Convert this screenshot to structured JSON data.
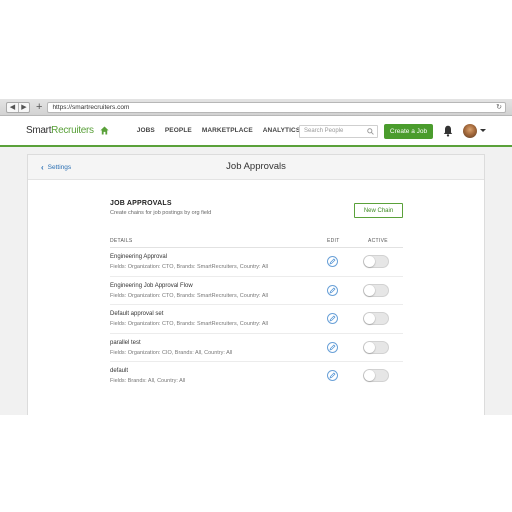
{
  "browser": {
    "url": "https://smartrecruiters.com"
  },
  "header": {
    "logo_smart": "Smart",
    "logo_recruiters": "Recruiters",
    "menu": [
      "JOBS",
      "PEOPLE",
      "MARKETPLACE",
      "ANALYTICS"
    ],
    "search_placeholder": "Search People",
    "create_job_label": "Create a Job",
    "accent_color": "#5aa13a"
  },
  "page": {
    "back_label": "Settings",
    "title": "Job Approvals"
  },
  "section": {
    "title": "JOB APPROVALS",
    "subtitle": "Create chains for job postings by org field",
    "new_chain_label": "New Chain"
  },
  "table": {
    "headers": {
      "details": "DETAILS",
      "edit": "EDIT",
      "active": "ACTIVE"
    },
    "rows": [
      {
        "name": "Engineering Approval",
        "fields": "Fields: Organization: CTO, Brands: SmartRecruiters, Country: All",
        "active": false
      },
      {
        "name": "Engineering Job Approval Flow",
        "fields": "Fields: Organization: CTO, Brands: SmartRecruiters, Country: All",
        "active": false
      },
      {
        "name": "Default approval set",
        "fields": "Fields: Organization: CTO, Brands: SmartRecruiters, Country: All",
        "active": false
      },
      {
        "name": "parallel test",
        "fields": "Fields: Organization: CIO, Brands: All, Country: All",
        "active": false
      },
      {
        "name": "default",
        "fields": "Fields: Brands: All, Country: All",
        "active": false
      }
    ]
  },
  "icons": [
    "back-icon",
    "forward-icon",
    "plus-icon",
    "reload-icon",
    "home-icon",
    "search-icon",
    "bell-icon",
    "avatar",
    "chevron-down-icon",
    "pencil-icon"
  ]
}
